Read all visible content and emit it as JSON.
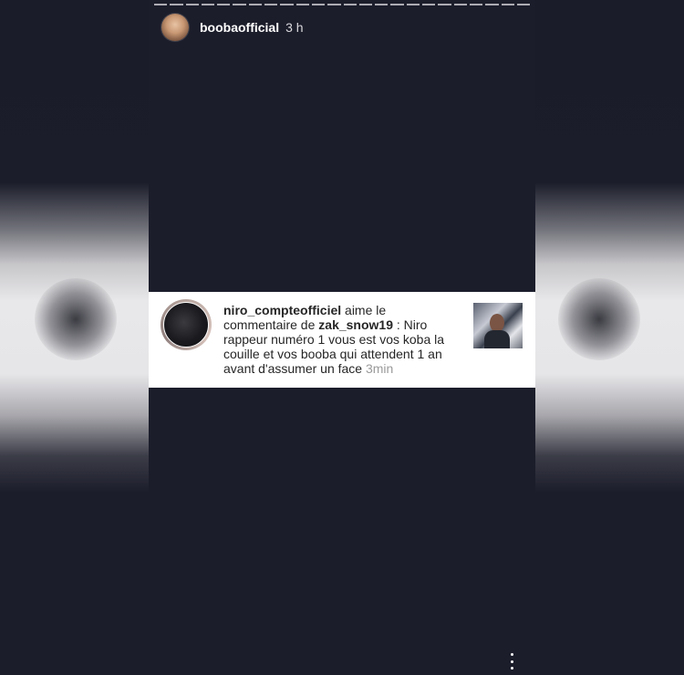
{
  "story": {
    "username": "boobaofficial",
    "time": "3 h",
    "progress_segments": 24,
    "avatar_icon": "profile-photo"
  },
  "notification": {
    "actor": "niro_compteofficiel",
    "text1": " aime le commentaire de ",
    "mentioned": "zak_snow19",
    "comment": " : Niro rappeur numéro 1 vous est vos koba la couille et vos booba qui attendent 1 an avant d'assumer un face ",
    "time": "3min"
  },
  "menu": {
    "icon": "more-vertical-icon"
  },
  "colors": {
    "background": "#1c1d2b",
    "card": "#ffffff",
    "text": "#262626",
    "muted": "#9a9a9a"
  }
}
